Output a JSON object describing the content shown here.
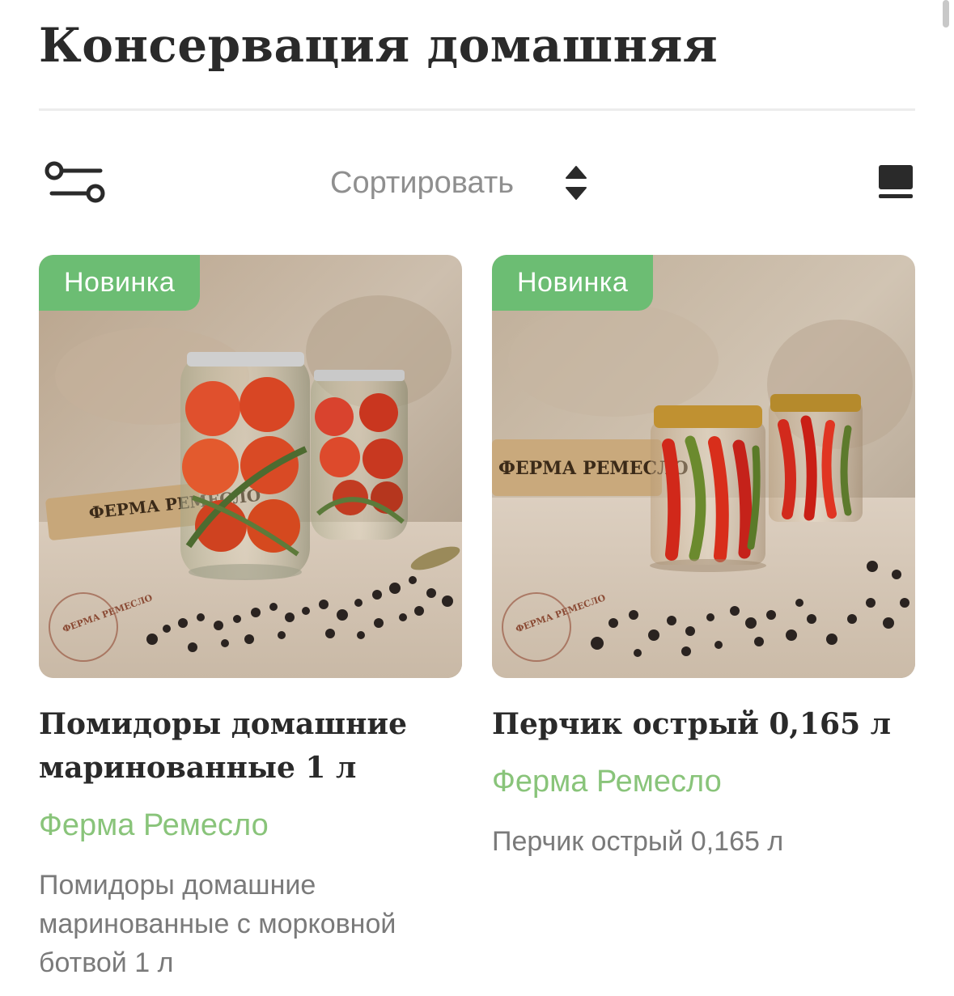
{
  "header": {
    "title": "Консервация домашняя"
  },
  "toolbar": {
    "filter_icon": "filter-sliders-icon",
    "sort_label": "Сортировать",
    "sort_icon": "sort-up-down-icon",
    "view_icon": "grid-view-icon"
  },
  "colors": {
    "badge": "#6cbd73",
    "vendor": "#89c47a",
    "title": "#2a2a2a",
    "muted": "#7a7a7a"
  },
  "products": [
    {
      "badge": "Новинка",
      "name": "Помидоры домашние маринованные 1 л",
      "vendor": "Ферма Ремесло",
      "description": "Помидоры домашние маринованные с морковной ботвой 1 л",
      "image_label": "ФЕРМА РЕМЕСЛО",
      "logo_text": "ФЕРМА РЕМЕСЛО"
    },
    {
      "badge": "Новинка",
      "name": "Перчик острый 0,165 л",
      "vendor": "Ферма Ремесло",
      "description": "Перчик острый 0,165 л",
      "image_label": "ФЕРМА РЕМЕСЛО",
      "logo_text": "ФЕРМА РЕМЕСЛО"
    }
  ]
}
